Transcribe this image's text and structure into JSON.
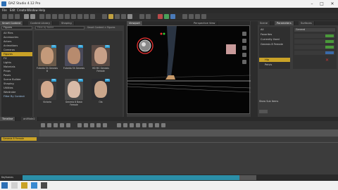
{
  "window": {
    "title": "DAZ Studio 4.12 Pro",
    "controls": [
      "–",
      "□",
      "✕"
    ]
  },
  "menu": [
    "File",
    "Edit",
    "Create",
    "Window",
    "Help"
  ],
  "left_panel": {
    "tabs": [
      "Smart Content",
      "Content Library",
      "Shaping"
    ],
    "dropdown": "Figures",
    "categories": [
      "All Files",
      "Accessories",
      "Actors",
      "Animations",
      "Cameras",
      "Figures",
      "FX",
      "Lights",
      "Materials",
      "Props",
      "Poses",
      "Scene Builder",
      "Shaping",
      "Utilities",
      "Wardrobe",
      "Filter By Context"
    ],
    "selected_category": "Figures",
    "filter_placeholder": "Filter by Name",
    "path": "Smart Content > Figures",
    "items": [
      {
        "label": "Futanta Sh Genesis 8",
        "badge": "ALL"
      },
      {
        "label": "Futanta Sh Genesis",
        "badge": "ALL"
      },
      {
        "label": "HD MC Genesis Female",
        "badge": "ALL"
      },
      {
        "label": "Victoria",
        "badge": "ALL"
      },
      {
        "label": "Genesis 8 Basic Female",
        "badge": "ALL"
      },
      {
        "label": "Ola",
        "badge": "ALL"
      }
    ]
  },
  "viewport": {
    "tabs": [
      "Viewport",
      "Perspective View"
    ],
    "camera": "Perspective View"
  },
  "right_panel": {
    "tabs": [
      "Scene",
      "Parameters",
      "Surfaces"
    ],
    "list_header": "All",
    "items": [
      "Favorites",
      "Currently Used",
      "Genesis 8 Female",
      "Pose Controls",
      "Actor",
      "Morphs"
    ],
    "properties": [
      "General",
      "Transforms",
      "Rotation",
      "Scale",
      "Translate"
    ],
    "tree_items": [
      "Genesis 8 Female",
      "Hip",
      "Pelvis"
    ],
    "checkbox_label": "Show Sub Items"
  },
  "timeline": {
    "tabs": [
      "Timeline",
      "aniMate2"
    ],
    "track_label": "Genesis 8 Female",
    "keyframe_label": "Keyframes"
  },
  "taskbar": {
    "items": [
      "",
      "",
      "",
      "",
      ""
    ]
  }
}
